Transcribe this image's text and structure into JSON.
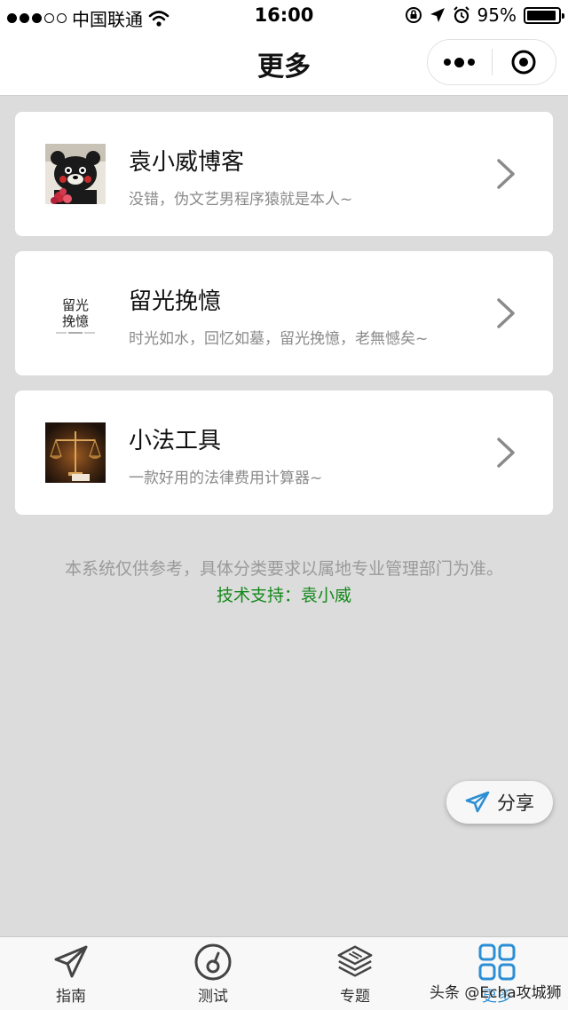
{
  "status_bar": {
    "carrier": "中国联通",
    "time": "16:00",
    "battery_pct": "95%",
    "battery_level": 0.95,
    "signal_bars_filled": 3,
    "signal_bars_total": 5
  },
  "nav": {
    "title": "更多",
    "more_icon": "more-dots-icon",
    "close_icon": "record-target-icon"
  },
  "cards": [
    {
      "title": "袁小威博客",
      "subtitle": "没错，伪文艺男程序猿就是本人~",
      "thumb": "bear-mascot-avatar"
    },
    {
      "title": "留光挽憶",
      "subtitle": "时光如水，回忆如墓，留光挽憶，老無憾矣~",
      "thumb": "calligraphy-logo",
      "logo_text": "留光\n挽憶"
    },
    {
      "title": "小法工具",
      "subtitle": "一款好用的法律费用计算器~",
      "thumb": "justice-scale-photo"
    }
  ],
  "footer": {
    "disclaimer": "本系统仅供参考，具体分类要求以属地专业管理部门为准。",
    "support": "技术支持：袁小威"
  },
  "share": {
    "label": "分享",
    "icon": "paper-plane-icon"
  },
  "tabs": [
    {
      "label": "指南",
      "icon": "paper-plane-icon",
      "active": false
    },
    {
      "label": "测试",
      "icon": "gauge-icon",
      "active": false
    },
    {
      "label": "专题",
      "icon": "layers-icon",
      "active": false
    },
    {
      "label": "更多",
      "icon": "grid-icon",
      "active": true
    }
  ],
  "watermark": "头条 @Echa攻城狮",
  "colors": {
    "background": "#dcdcdc",
    "accent_green": "#14891b",
    "active_tab": "#2c8ed4"
  }
}
